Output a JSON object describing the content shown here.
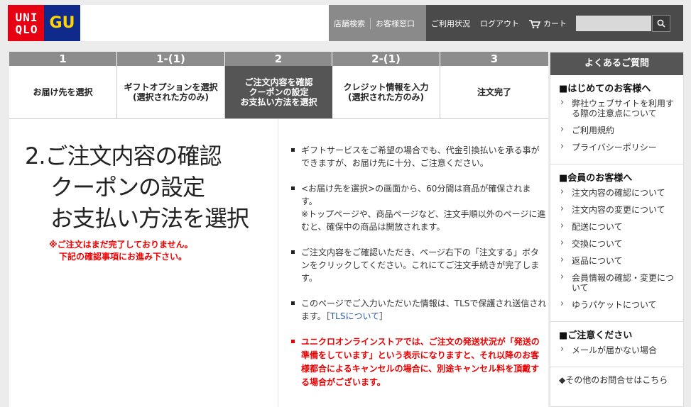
{
  "header": {
    "logo_uniqlo_line1": "UNI",
    "logo_uniqlo_line2": "QLO",
    "logo_gu": "GU",
    "nav_store": "店舗検索",
    "nav_contact": "お客様窓口",
    "nav_usage": "ご利用状況",
    "nav_logout": "ログアウト",
    "nav_cart": "カート",
    "search_placeholder": ""
  },
  "steps": [
    {
      "num": "1",
      "label": "お届け先を選択",
      "active": false
    },
    {
      "num": "1-(1)",
      "label": "ギフトオプションを選択\n(選択された方のみ)",
      "active": false
    },
    {
      "num": "2",
      "label": "ご注文内容を確認\nクーポンの設定\nお支払い方法を選択",
      "active": true
    },
    {
      "num": "2-(1)",
      "label": "クレジット情報を入力\n(選択された方のみ)",
      "active": false
    },
    {
      "num": "3",
      "label": "注文完了",
      "active": false
    }
  ],
  "main": {
    "heading_line1": "2.ご注文内容の確認",
    "heading_line2": "クーポンの設定",
    "heading_line3": "お支払い方法を選択",
    "warning_line1": "※ご注文はまだ完了しておりません。",
    "warning_line2": "下記の確認事項にお進み下さい。",
    "notes": [
      "ギフトサービスをご希望の場合でも、代金引換払いを承る事ができますが、お届け先に十分、ご注意ください。",
      "<お届け先を選択>の画面から、60分間は商品が確保されます。",
      "※トップページや、商品ページなど、注文手順以外のページに進むと、確保中の商品は開放されます。",
      "ご注文内容をご確認いただき、ページ右下の「注文する」ボタンをクリックしてください。これにてご注文手続きが完了します。",
      "このページでご入力いただいた情報は、TLSで保護され送信されます。［",
      "TLSについて",
      "］",
      "ユニクロオンラインストアでは、ご注文の発送状況が「発送の準備をしています」という表示になりますと、それ以降のお客様都合によるキャンセルの場合に、別途キャンセル料を頂戴する場合がございます。"
    ]
  },
  "faq": {
    "title": "よくあるご質問",
    "sections": [
      {
        "title": "■はじめてのお客様へ",
        "links": [
          "弊社ウェブサイトを利用する際の注意点について",
          "ご利用規約",
          "プライバシーポリシー"
        ]
      },
      {
        "title": "■会員のお客様へ",
        "links": [
          "注文内容の確認について",
          "注文内容の変更について",
          "配送について",
          "交換について",
          "返品について",
          "会員情報の確認・変更について",
          "ゆうパケットについて"
        ]
      },
      {
        "title": "■ご注意ください",
        "links": [
          "メールが届かない場合"
        ]
      }
    ],
    "other": "◆その他のお問合せはこちら"
  }
}
